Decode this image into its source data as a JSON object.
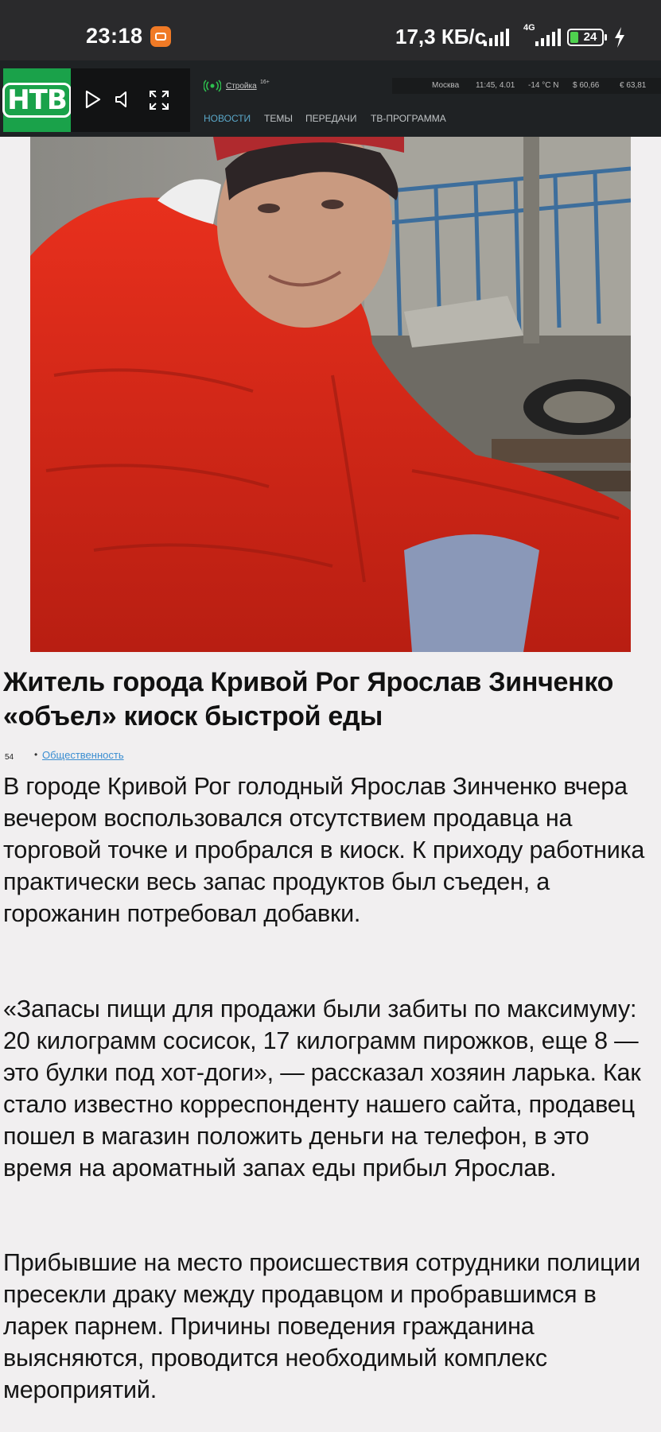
{
  "status_bar": {
    "time": "23:18",
    "network_speed": "17,3 КБ/с",
    "network_type": "4G",
    "battery": "24"
  },
  "header": {
    "logo": "НТВ",
    "live_label": "Стройка",
    "age_rating": "16+",
    "ticker": {
      "city": "Москва",
      "datetime": "11:45, 4.01",
      "weather": "-14 °C N",
      "usd": "$ 60,66",
      "eur": "€ 63,81"
    },
    "nav": [
      "НОВОСТИ",
      "ТЕМЫ",
      "ПЕРЕДАЧИ",
      "ТВ-ПРОГРАММА"
    ]
  },
  "article": {
    "headline": "Житель города Кривой Рог Ярослав Зинченко «объел» киоск быстрой еды",
    "meta_icon": "54",
    "category": "Общественность",
    "paragraphs": [
      "В городе Кривой Рог голодный Ярослав Зинченко вчера вечером воспользовался отсутствием продавца на торговой точке и пробрался в киоск. К приходу работника практически весь запас продуктов был съеден, а горожанин потребовал добавки.",
      "«Запасы пищи для продажи были забиты по максимуму: 20 килограмм сосисок, 17 килограмм пирожков, еще 8 — это булки под хот-доги», — рассказал хозяин ларька. Как стало известно корреспонденту нашего сайта, продавец пошел в магазин положить деньги на телефон, в это время на ароматный запах еды прибыл Ярослав.",
      "Прибывшие на место происшествия сотрудники полиции пресекли драку между продавцом и пробравшимся в ларек парнем. Причины поведения гражданина выясняются, проводится необходимый комплекс мероприятий."
    ]
  },
  "colors": {
    "status_bar_bg": "#2a2a2c",
    "header_bg": "#1f2224",
    "logo_green": "#1aa24a",
    "nav_active": "#5aa7c8",
    "link_blue": "#3b8ed1",
    "page_bg": "#f1eff0"
  },
  "icons": [
    "app-notification-icon",
    "signal-icon",
    "battery-icon",
    "charging-icon",
    "play-icon",
    "volume-icon",
    "fullscreen-icon",
    "live-broadcast-icon"
  ]
}
